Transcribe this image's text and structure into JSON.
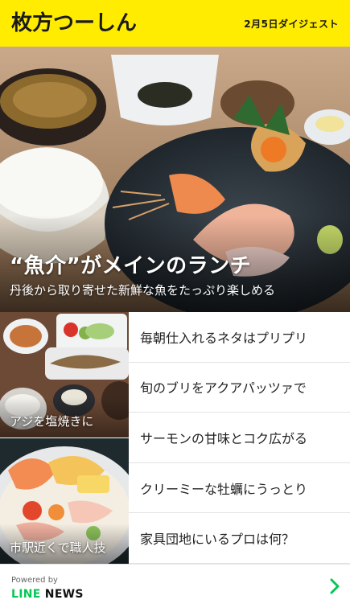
{
  "header": {
    "logo": "枚方つーしん",
    "digest_label": "2月5日ダイジェスト",
    "background": "#ffec00"
  },
  "hero": {
    "title": "“魚介”がメインのランチ",
    "subtitle": "丹後から取り寄せた新鮮な魚をたっぷり楽しめる"
  },
  "thumbnails": [
    {
      "label": "アジを塩焼きに"
    },
    {
      "label": "市駅近くで職人技"
    }
  ],
  "list": [
    {
      "text": "毎朝仕入れるネタはプリプリ"
    },
    {
      "text": "旬のブリをアクアパッツァで"
    },
    {
      "text": "サーモンの甘味とコク広がる"
    },
    {
      "text": "クリーミーな牡蠣にうっとり"
    },
    {
      "text": "家具団地にいるプロは何？"
    }
  ],
  "footer": {
    "powered_by": "Powered by",
    "brand_line": "LINE",
    "brand_news": " NEWS",
    "chevron_icon": "chevron-right-icon",
    "accent": "#06c755"
  }
}
